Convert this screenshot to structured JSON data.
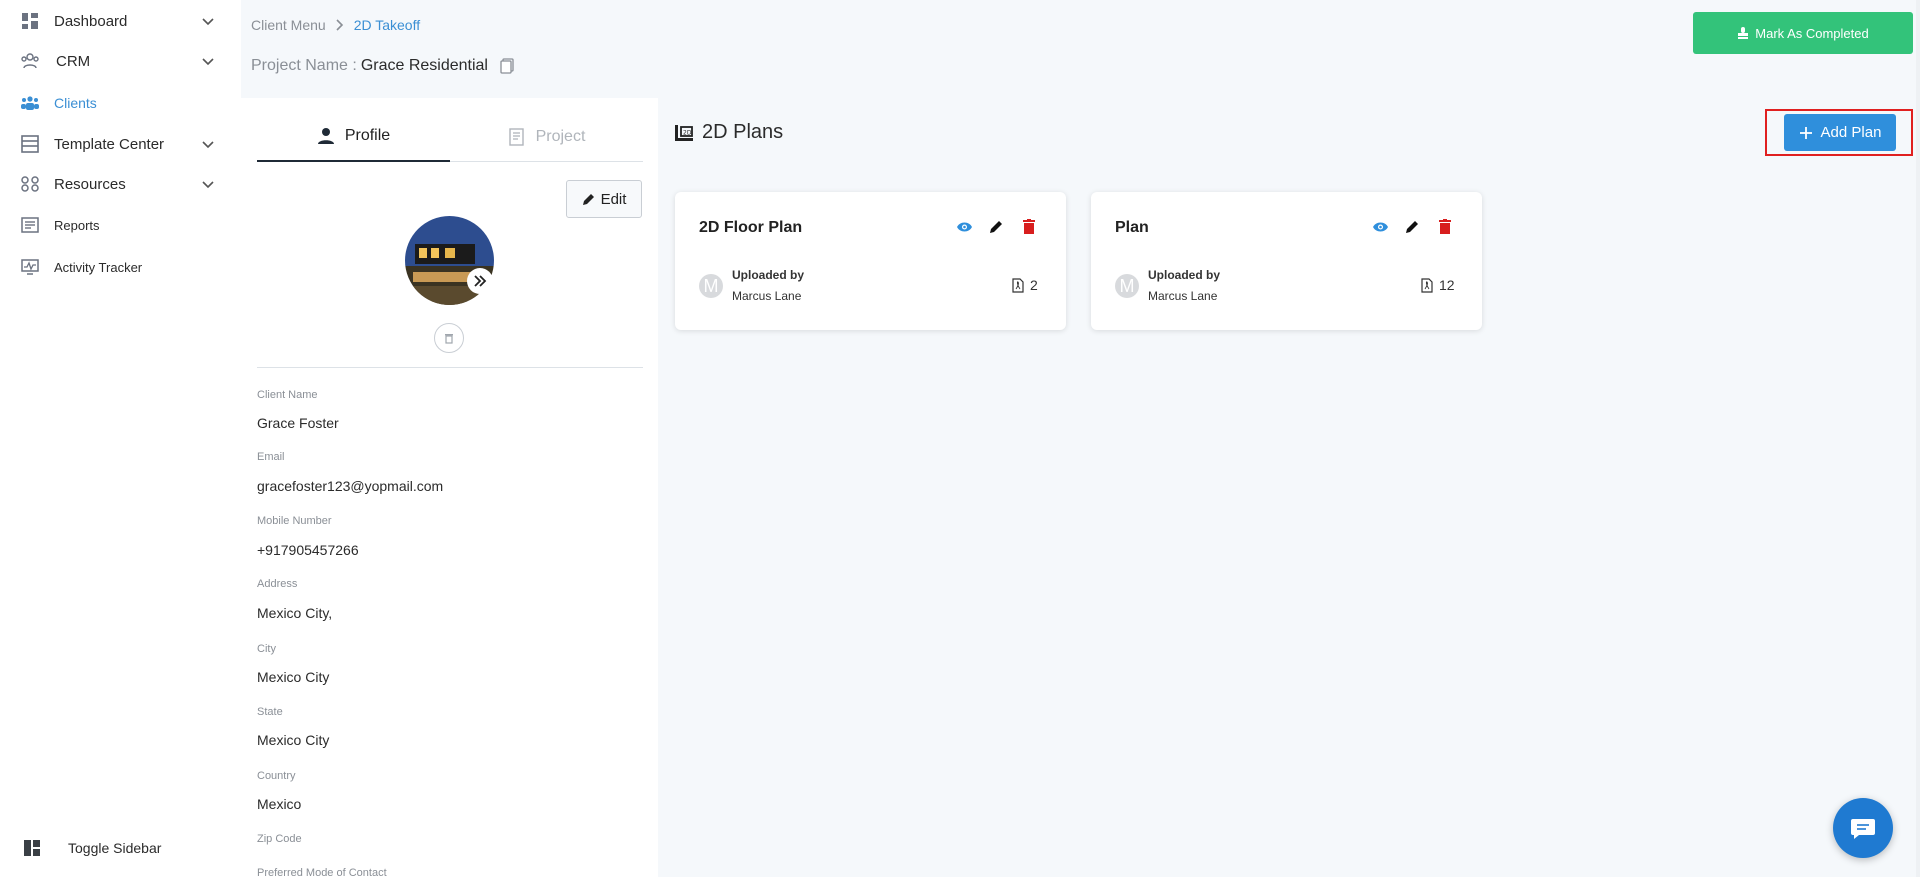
{
  "sidebar": {
    "items": [
      {
        "label": "Dashboard",
        "icon": "dashboard-icon",
        "has_chevron": true
      },
      {
        "label": "CRM",
        "icon": "crm-icon",
        "has_chevron": true
      },
      {
        "label": "Clients",
        "icon": "clients-icon",
        "has_chevron": false,
        "active": true
      },
      {
        "label": "Template Center",
        "icon": "template-icon",
        "has_chevron": true
      },
      {
        "label": "Resources",
        "icon": "resources-icon",
        "has_chevron": true
      },
      {
        "label": "Reports",
        "icon": "reports-icon",
        "has_chevron": false
      },
      {
        "label": "Activity Tracker",
        "icon": "activity-icon",
        "has_chevron": false
      }
    ],
    "toggle_label": "Toggle Sidebar"
  },
  "header": {
    "breadcrumb": [
      "Client Menu",
      "2D Takeoff"
    ],
    "project_label": "Project Name :",
    "project_name": "Grace Residential",
    "mark_completed_label": "Mark As Completed"
  },
  "profile": {
    "tabs": [
      {
        "label": "Profile",
        "icon": "user-icon",
        "active": true
      },
      {
        "label": "Project",
        "icon": "project-icon",
        "active": false
      }
    ],
    "edit_label": "Edit",
    "fields": [
      {
        "label": "Client Name",
        "value": "Grace Foster"
      },
      {
        "label": "Email",
        "value": "gracefoster123@yopmail.com"
      },
      {
        "label": "Mobile Number",
        "value": "+917905457266"
      },
      {
        "label": "Address",
        "value": "Mexico City,"
      },
      {
        "label": "City",
        "value": "Mexico City"
      },
      {
        "label": "State",
        "value": "Mexico City"
      },
      {
        "label": "Country",
        "value": "Mexico"
      },
      {
        "label": "Zip Code",
        "value": ""
      },
      {
        "label": "Preferred Mode of Contact",
        "value": ""
      }
    ]
  },
  "plans": {
    "title": "2D Plans",
    "add_label": "Add Plan",
    "cards": [
      {
        "title": "2D Floor Plan",
        "uploaded_by_label": "Uploaded by",
        "uploader": "Marcus Lane",
        "avatar_initial": "M",
        "file_count": "2"
      },
      {
        "title": "Plan",
        "uploaded_by_label": "Uploaded by",
        "uploader": "Marcus Lane",
        "avatar_initial": "M",
        "file_count": "12"
      }
    ]
  },
  "colors": {
    "accent": "#2f8fdc",
    "success": "#33c37a",
    "danger": "#e02020",
    "highlight_box": "#e02020"
  }
}
